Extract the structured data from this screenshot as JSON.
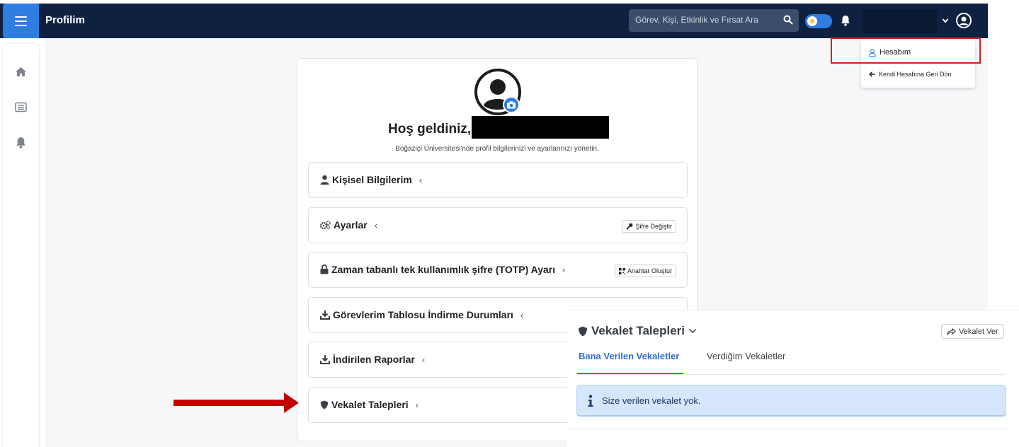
{
  "navbar": {
    "title": "Profilim",
    "search_placeholder": "Görev, Kişi, Etkinlik ve Fırsat Ara",
    "accent_color": "#2f7de1",
    "bg_color": "#0f2140"
  },
  "sidebar": {
    "icons": [
      "home-icon",
      "list-icon",
      "bell-icon"
    ]
  },
  "dropdown": {
    "items": [
      {
        "label": "Hesabım",
        "icon": "user-outline-icon"
      },
      {
        "label": "Kendi Hesabına Geri Dön",
        "icon": "arrow-left-icon"
      }
    ]
  },
  "profile": {
    "welcome": "Hoş geldiniz,",
    "subtitle": "Boğaziçi Üniversitesi'nde profil bilgilerinizi ve ayarlarınızı yönetin.",
    "sections": [
      {
        "label": "Kişisel Bilgilerim",
        "icon": "user-icon",
        "button": ""
      },
      {
        "label": "Ayarlar",
        "icon": "gears-icon",
        "button": "Şifre Değiştir"
      },
      {
        "label": "Zaman tabanlı tek kullanımlık şifre (TOTP) Ayarı",
        "icon": "lock-icon",
        "button": "Anahtar Oluştur"
      },
      {
        "label": "Görevlerim Tablosu İndirme Durumları",
        "icon": "download-icon",
        "button": ""
      },
      {
        "label": "İndirilen Raporlar",
        "icon": "download-icon",
        "button": ""
      },
      {
        "label": "Vekalet Talepleri",
        "icon": "shield-icon",
        "button": ""
      }
    ]
  },
  "vekalet_panel": {
    "title": "Vekalet Talepleri",
    "action_button": "Vekalet Ver",
    "tabs": [
      {
        "label": "Bana Verilen Vekaletler",
        "active": true
      },
      {
        "label": "Verdiğim Vekaletler",
        "active": false
      }
    ],
    "alert_text": "Size verilen vekalet yok."
  }
}
